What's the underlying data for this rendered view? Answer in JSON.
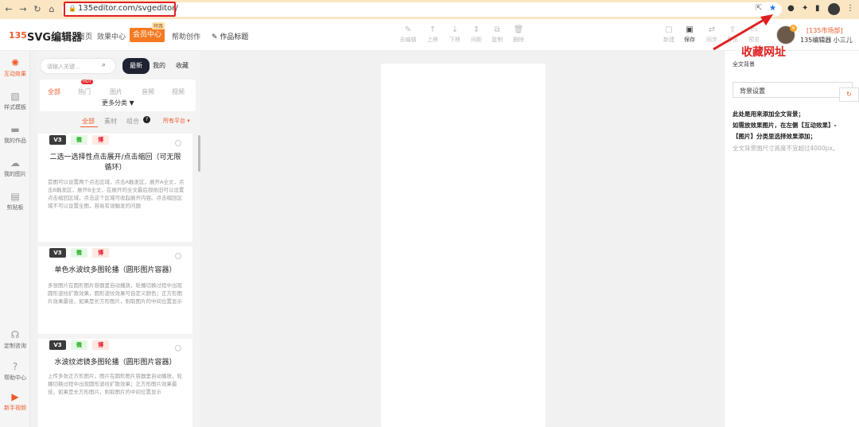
{
  "browser": {
    "url": "135editor.com/svgeditor/"
  },
  "header": {
    "logo_mark": "135",
    "logo_text": "SVG编辑器",
    "nav": [
      "首页",
      "效果中心",
      "会员中心",
      "帮助创作"
    ],
    "vip_tag": "特惠",
    "title_edit": "作品标题",
    "tools_center": [
      "去编辑",
      "上移",
      "下移",
      "间距",
      "复制",
      "删除"
    ],
    "tools_right": [
      "新建",
      "保存",
      "同步",
      "导出",
      "预览"
    ],
    "user_link": "[135市场部]",
    "user_name": "135编辑器 小三儿"
  },
  "leftbar": {
    "items": [
      "互动效果",
      "样式模板",
      "我的作品",
      "我的图片",
      "剪贴板"
    ],
    "bottom": [
      "定制咨询",
      "帮助中心",
      "新手视频"
    ]
  },
  "panel": {
    "search_placeholder": "请输入关键...",
    "sort": [
      "最新",
      "我的",
      "收藏"
    ],
    "categories": [
      "全部",
      "热门",
      "图片",
      "音频",
      "视频"
    ],
    "hot_badge": "HOT",
    "more": "更多分类 ▼",
    "filters": [
      "全部",
      "素材",
      "组合"
    ],
    "platform": "所有平台 ▾",
    "badges": [
      "V3",
      "微",
      "博"
    ],
    "cards": [
      {
        "title": "二选一选择性点击展开/点击缩回（可无限循环）",
        "desc": "首图可以设置两个点击区域，点击A触发区，展开A全文，点击B触发区，展开B全文，在展开的全文最后部依旧可以设置点击缩回区域，点击这个区域可收起展开内容。点击缩回区域不可以设置全图，容易有误触发的问题"
      },
      {
        "title": "单色水波纹多图轮播（圆形图片容器）",
        "desc": "多张图片在圆形图片容器里自动播放，轮播切换过程中出现圆形波纹扩散效果，圆形波纹效果可自定义颜色；正方形图片效果最佳，如果是长方形图片，则取图片的中间位置显示"
      },
      {
        "title": "水波纹滤镜多图轮播（圆形图片容器）",
        "desc": "上传多张正方形图片，图片在圆形图片容器里自动播放，轮播切换过程中出现圆形波纹扩散效果；正方形图片效果最佳，如果是长方形图片，则取图片的中间位置显示"
      }
    ]
  },
  "right_panel": {
    "title": "全文背景",
    "bg_setting": "背景设置",
    "line1": "此处是用来添加全文背景；",
    "line2": "如需放效果图片，在左侧【互动效果】-",
    "line3": "【图片】分类里选择效果添加；",
    "note": "全文背景图尺寸高度不宜超过4000px。",
    "side_tab": "↻"
  },
  "annotation": {
    "text": "收藏网址"
  }
}
